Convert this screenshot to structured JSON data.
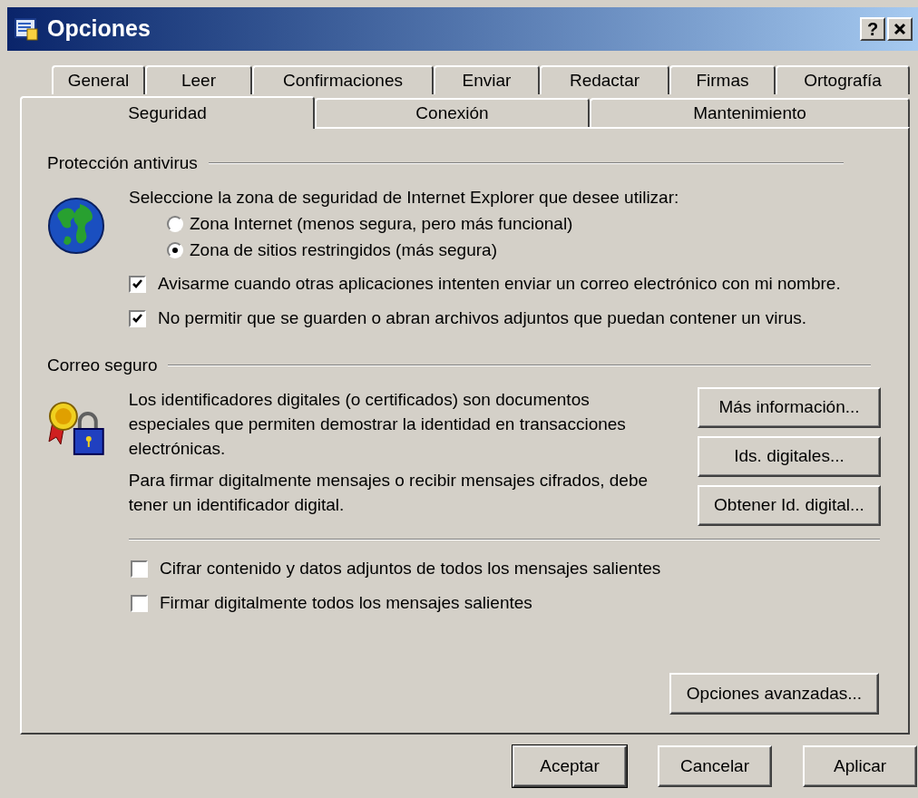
{
  "window": {
    "title": "Opciones",
    "help_button": "?"
  },
  "tabs_row_1": [
    {
      "label": "General",
      "selected": false
    },
    {
      "label": "Leer",
      "selected": false
    },
    {
      "label": "Confirmaciones",
      "selected": false
    },
    {
      "label": "Enviar",
      "selected": false
    },
    {
      "label": "Redactar",
      "selected": false
    },
    {
      "label": "Firmas",
      "selected": false
    },
    {
      "label": "Ortografía",
      "selected": false
    }
  ],
  "tabs_row_2": [
    {
      "label": "Seguridad",
      "selected": true
    },
    {
      "label": "Conexión",
      "selected": false
    },
    {
      "label": "Mantenimiento",
      "selected": false
    }
  ],
  "antivirus": {
    "heading": "Protección antivirus",
    "prompt": "Seleccione la zona de seguridad de Internet Explorer que desee utilizar:",
    "zones": [
      {
        "label": "Zona Internet (menos segura, pero más funcional)",
        "selected": false
      },
      {
        "label": "Zona de sitios restringidos (más segura)",
        "selected": true
      }
    ],
    "options": [
      {
        "label": "Avisarme cuando otras aplicaciones intenten enviar un correo electrónico con mi nombre.",
        "checked": true
      },
      {
        "label": "No permitir que se guarden o abran archivos adjuntos que puedan contener un virus.",
        "checked": true
      }
    ]
  },
  "secure_mail": {
    "heading": "Correo seguro",
    "description": "Los identificadores digitales (o certificados) son documentos especiales que permiten demostrar la identidad en transacciones electrónicas.",
    "note": "Para firmar digitalmente mensajes o recibir mensajes cifrados, debe tener un identificador digital.",
    "buttons": [
      "Más información...",
      "Ids. digitales...",
      "Obtener Id. digital..."
    ],
    "options": [
      {
        "label": "Cifrar contenido y datos adjuntos de todos los mensajes salientes",
        "checked": false
      },
      {
        "label": "Firmar digitalmente todos los mensajes salientes",
        "checked": false
      }
    ],
    "advanced_button": "Opciones avanzadas..."
  },
  "footer_buttons": [
    {
      "label": "Aceptar",
      "default": true
    },
    {
      "label": "Cancelar",
      "default": false
    },
    {
      "label": "Aplicar",
      "default": false
    }
  ]
}
